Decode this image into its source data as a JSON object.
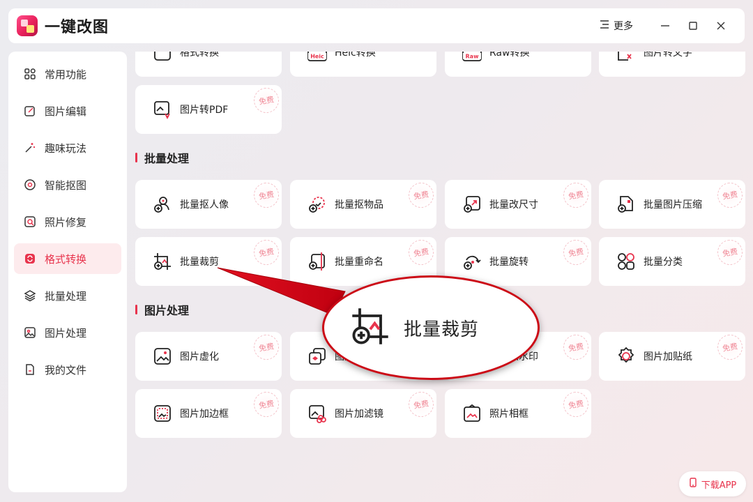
{
  "app": {
    "title": "一键改图"
  },
  "titlebar": {
    "more_label": "更多"
  },
  "sidebar": {
    "items": [
      {
        "label": "常用功能",
        "icon": "grid-icon",
        "active": false
      },
      {
        "label": "图片编辑",
        "icon": "edit-icon",
        "active": false
      },
      {
        "label": "趣味玩法",
        "icon": "magic-wand-icon",
        "active": false
      },
      {
        "label": "智能抠图",
        "icon": "cutout-icon",
        "active": false
      },
      {
        "label": "照片修复",
        "icon": "repair-icon",
        "active": false
      },
      {
        "label": "格式转换",
        "icon": "convert-icon",
        "active": true
      },
      {
        "label": "批量处理",
        "icon": "layers-icon",
        "active": false
      },
      {
        "label": "图片处理",
        "icon": "image-icon",
        "active": false
      },
      {
        "label": "我的文件",
        "icon": "file-icon",
        "active": false
      }
    ]
  },
  "format_convert": {
    "cards": [
      {
        "label": "格式转换",
        "icon": "format-convert-icon"
      },
      {
        "label": "Heic转换",
        "icon": "heic-icon",
        "tag": "Heic"
      },
      {
        "label": "Raw转换",
        "icon": "raw-icon",
        "tag": "Raw"
      },
      {
        "label": "图片转文字",
        "icon": "image-to-text-icon"
      },
      {
        "label": "图片转PDF",
        "icon": "image-to-pdf-icon",
        "free": true
      }
    ]
  },
  "batch": {
    "title": "批量处理",
    "cards": [
      {
        "label": "批量抠人像",
        "icon": "batch-portrait-cutout-icon",
        "free": true
      },
      {
        "label": "批量抠物品",
        "icon": "batch-object-cutout-icon",
        "free": true
      },
      {
        "label": "批量改尺寸",
        "icon": "batch-resize-icon",
        "free": true
      },
      {
        "label": "批量图片压缩",
        "icon": "batch-compress-icon",
        "free": true
      },
      {
        "label": "批量裁剪",
        "icon": "batch-crop-icon",
        "free": true
      },
      {
        "label": "批量重命名",
        "icon": "batch-rename-icon",
        "free": true
      },
      {
        "label": "批量旋转",
        "icon": "batch-rotate-icon",
        "free": true
      },
      {
        "label": "批量分类",
        "icon": "batch-classify-icon",
        "free": true
      }
    ]
  },
  "image_proc": {
    "title": "图片处理",
    "cards": [
      {
        "label": "图片虚化",
        "icon": "blur-icon",
        "free": true
      },
      {
        "label": "图片叠加",
        "icon": "overlay-icon",
        "free": true
      },
      {
        "label": "图片加水印",
        "icon": "watermark-icon",
        "free": true
      },
      {
        "label": "图片加贴纸",
        "icon": "sticker-icon",
        "free": true
      },
      {
        "label": "图片加边框",
        "icon": "border-icon",
        "free": true
      },
      {
        "label": "图片加滤镜",
        "icon": "filter-icon",
        "free": true
      },
      {
        "label": "照片相框",
        "icon": "photo-frame-icon",
        "free": true
      }
    ]
  },
  "free_badge": "免费",
  "download": {
    "label": "下载APP"
  },
  "callout": {
    "label": "批量裁剪"
  },
  "colors": {
    "accent": "#e8344d",
    "callout": "#cc0a16"
  }
}
